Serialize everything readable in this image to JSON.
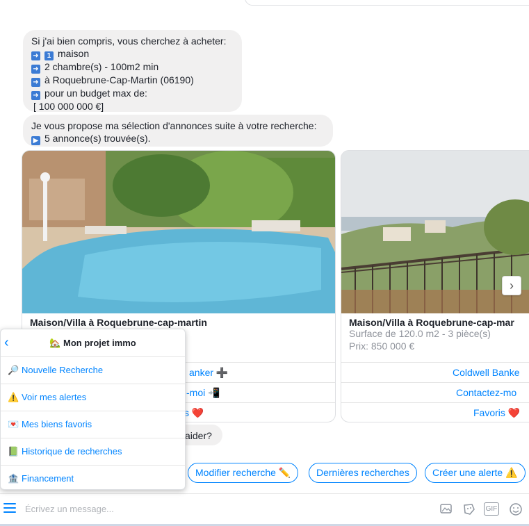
{
  "messages": {
    "summary": {
      "intro": "Si j'ai bien compris, vous cherchez à acheter:",
      "line1": "maison",
      "line2": "2 chambre(s) - 100m2 min",
      "line3": "à Roquebrune-Cap-Martin (06190)",
      "line4": "pour un budget max de:",
      "budget": "[ 100 000 000 €]",
      "count_emoji": "1",
      "arrow": "➡"
    },
    "proposal": {
      "line1": "Je vous propose ma sélection d'annonces suite à votre recherche:",
      "line2": "5 annonce(s) trouvée(s).",
      "play": "▶"
    },
    "help_tail": "aider?"
  },
  "cards": [
    {
      "title": "Maison/Villa à Roquebrune-cap-martin",
      "subtitle": "",
      "price": "",
      "btn_agency": "anker ➕",
      "btn_contact": "-moi 📲",
      "btn_fav": "s ❤️"
    },
    {
      "title": "Maison/Villa à Roquebrune-cap-mar",
      "subtitle": "Surface de 120.0 m2 - 3 pièce(s)",
      "price": "Prix: 850 000 €",
      "btn_agency": "Coldwell Banke",
      "btn_contact": "Contactez-mo",
      "btn_fav": "Favoris ❤️"
    }
  ],
  "quick_replies": {
    "modify": "Modifier recherche ✏️",
    "recent": "Dernières recherches",
    "alert": "Créer une alerte ⚠️"
  },
  "menu": {
    "title": "🏡 Mon projet immo",
    "items": [
      {
        "icon": "🔎",
        "label": "Nouvelle Recherche"
      },
      {
        "icon": "⚠️",
        "label": "Voir mes alertes"
      },
      {
        "icon": "💌",
        "label": "Mes biens favoris"
      },
      {
        "icon": "📗",
        "label": "Historique de recherches"
      },
      {
        "icon": "🏦",
        "label": "Financement"
      }
    ]
  },
  "composer": {
    "placeholder": "Écrivez un message...",
    "gif": "GIF"
  },
  "colors": {
    "accent": "#0084ff",
    "bubble": "#f1f0f0"
  },
  "icons": [
    "menu-icon",
    "photo-icon",
    "sticker-icon",
    "gif-icon",
    "emoji-icon",
    "chevron-left-icon",
    "chevron-right-icon"
  ]
}
